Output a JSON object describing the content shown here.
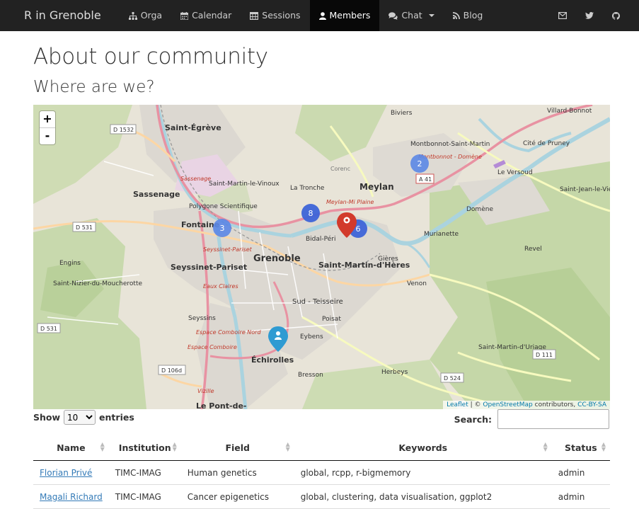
{
  "nav": {
    "brand": "R in Grenoble",
    "items": [
      {
        "label": "Orga",
        "icon": "sitemap-icon"
      },
      {
        "label": "Calendar",
        "icon": "calendar-icon"
      },
      {
        "label": "Sessions",
        "icon": "table-icon"
      },
      {
        "label": "Members",
        "icon": "user-icon",
        "active": true
      },
      {
        "label": "Chat",
        "icon": "comments-icon",
        "dropdown": true
      },
      {
        "label": "Blog",
        "icon": "rss-icon"
      }
    ],
    "right_icons": [
      "envelope-icon",
      "twitter-icon",
      "github-icon"
    ]
  },
  "page": {
    "title": "About our community",
    "subtitle": "Where are we?"
  },
  "map": {
    "zoom_in": "+",
    "zoom_out": "-",
    "attribution": {
      "leaflet": "Leaflet",
      "sep": " | © ",
      "osm": "OpenStreetMap",
      "contrib": " contributors, ",
      "license": "CC-BY-SA"
    },
    "clusters": [
      "2",
      "8",
      "3",
      "6"
    ],
    "places": [
      "Saint-Égrève",
      "Biviers",
      "Montbonnot-Saint-Martin",
      "Cité de Pruney",
      "Villard-Bonnot",
      "Sassenage",
      "Saint-Martin-le-Vinoux",
      "La Tronche",
      "Meylan",
      "Corenc",
      "Le Versoud",
      "Saint-Jean-le-Vieux",
      "Polygone Scientifique",
      "Domène",
      "Fontaine",
      "Grenoble",
      "Bidal-Péri",
      "Murianette",
      "Seyssinet-Pariset",
      "Saint-Martin-d'Hères",
      "Gières",
      "Revel",
      "Engins",
      "Saint-Nizier-du-Moucherotte",
      "Venon",
      "Sud - Teisseire",
      "Seyssins",
      "Poisat",
      "Eybens",
      "Saint-Martin-d'Uriage",
      "Échirolles",
      "Bresson",
      "Herbeys",
      "Le Pont-de-",
      "Sassenage",
      "Seyssinet-Pariset",
      "Eaux Claires",
      "Espace Comboire Nord",
      "Espace Comboire",
      "Meylan-Mi Plaine",
      "Montbonnot - Domène",
      "Vizille"
    ],
    "roads": [
      "D 1532",
      "D 531",
      "A 41",
      "D 531",
      "D 106d",
      "D 524",
      "D 111"
    ]
  },
  "table_controls": {
    "show": "Show",
    "entries_value": "10",
    "entries": "entries",
    "search_label": "Search:",
    "search_value": ""
  },
  "table": {
    "columns": [
      "Name",
      "Institution",
      "Field",
      "Keywords",
      "Status"
    ],
    "rows": [
      {
        "name": "Florian Privé",
        "institution": "TIMC-IMAG",
        "field": "Human genetics",
        "keywords": "global, rcpp, r-bigmemory",
        "status": "admin"
      },
      {
        "name": "Magali Richard",
        "institution": "TIMC-IMAG",
        "field": "Cancer epigenetics",
        "keywords": "global, clustering, data visualisation, ggplot2",
        "status": "admin"
      }
    ]
  }
}
